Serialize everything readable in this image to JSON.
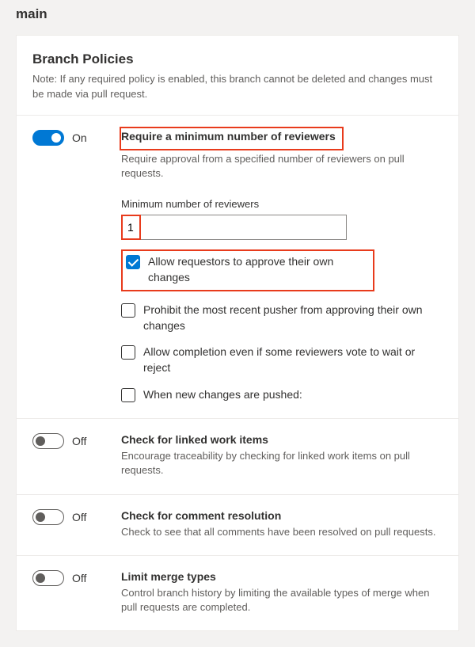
{
  "branch_name": "main",
  "header": {
    "title": "Branch Policies",
    "note": "Note: If any required policy is enabled, this branch cannot be deleted and changes must be made via pull request."
  },
  "policies": {
    "min_reviewers": {
      "state": "On",
      "title": "Require a minimum number of reviewers",
      "desc": "Require approval from a specified number of reviewers on pull requests.",
      "field_label": "Minimum number of reviewers",
      "field_value": "1",
      "opts": {
        "allow_self": "Allow requestors to approve their own changes",
        "prohibit_pusher": "Prohibit the most recent pusher from approving their own changes",
        "allow_completion": "Allow completion even if some reviewers vote to wait or reject",
        "new_changes": "When new changes are pushed:"
      }
    },
    "linked_items": {
      "state": "Off",
      "title": "Check for linked work items",
      "desc": "Encourage traceability by checking for linked work items on pull requests."
    },
    "comment_res": {
      "state": "Off",
      "title": "Check for comment resolution",
      "desc": "Check to see that all comments have been resolved on pull requests."
    },
    "limit_merge": {
      "state": "Off",
      "title": "Limit merge types",
      "desc": "Control branch history by limiting the available types of merge when pull requests are completed."
    }
  }
}
